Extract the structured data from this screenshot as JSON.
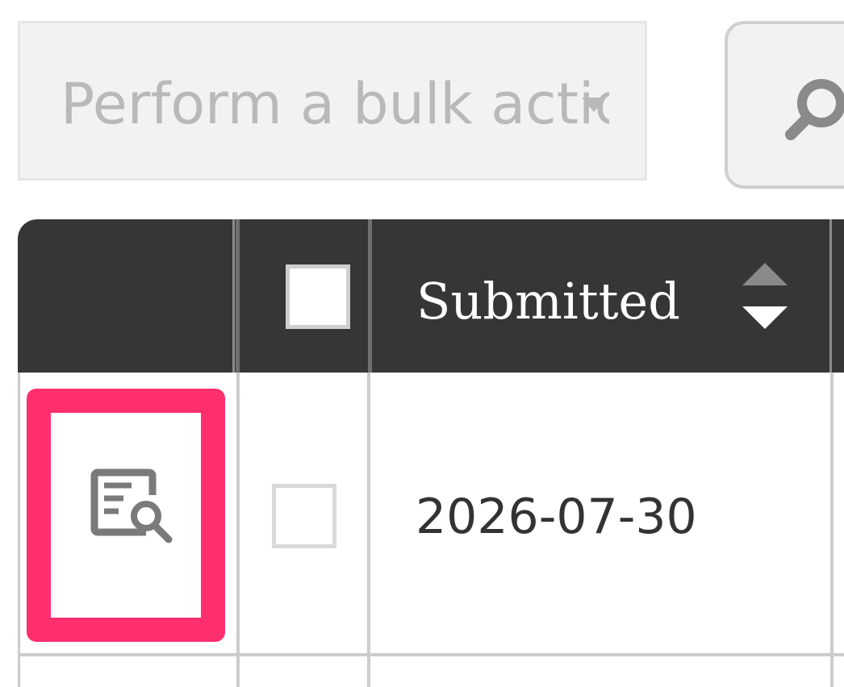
{
  "bulk_action": {
    "placeholder": "Perform a bulk actio",
    "caret_icon": "chevron-down-icon"
  },
  "search_button": {
    "icon": "search-icon"
  },
  "table": {
    "header_color": "#363636",
    "highlight_color": "#ff2f6d",
    "columns": [
      {
        "key": "view",
        "label": ""
      },
      {
        "key": "select",
        "label": ""
      },
      {
        "key": "submitted",
        "label": "Submitted",
        "sortable": true
      }
    ],
    "rows": [
      {
        "submitted": "2026-07-30",
        "view_icon": "document-search-icon",
        "checked": false
      }
    ]
  }
}
